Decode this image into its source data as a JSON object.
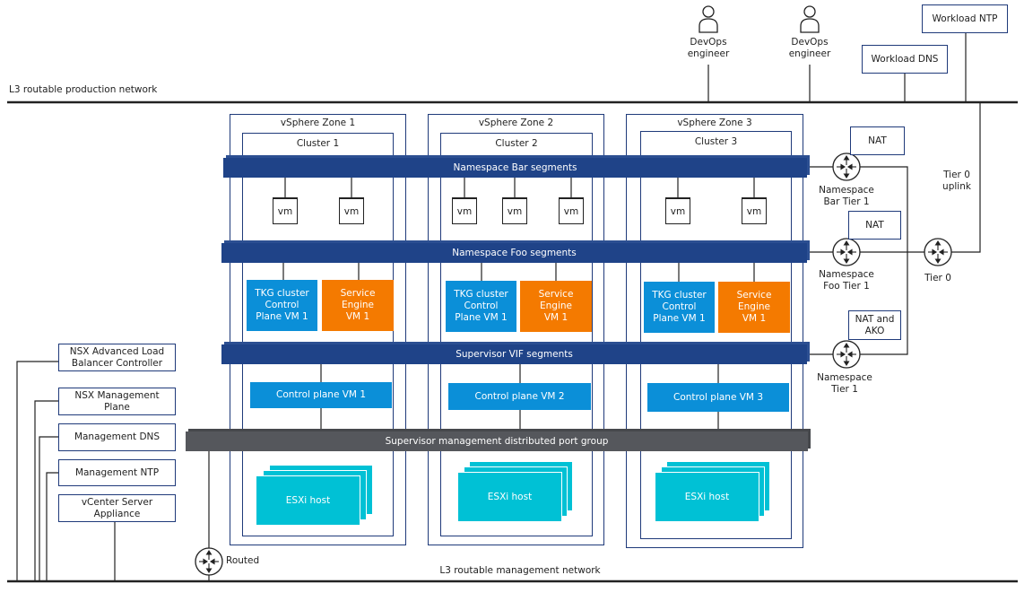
{
  "networks": {
    "production": "L3 routable production network",
    "management": "L3 routable management network"
  },
  "top": {
    "devops": [
      "DevOps\nengineer",
      "DevOps\nengineer"
    ],
    "workload_ntp": "Workload NTP",
    "workload_dns": "Workload DNS",
    "tier0_uplink": "Tier 0\nuplink"
  },
  "zones": [
    {
      "label": "vSphere Zone 1",
      "cluster": "Cluster 1",
      "tkg": "TKG cluster\nControl\nPlane VM 1",
      "se": "Service\nEngine\nVM 1",
      "cp": "Control plane VM 1",
      "esxi": "ESXi host"
    },
    {
      "label": "vSphere Zone 2",
      "cluster": "Cluster 2",
      "tkg": "TKG cluster\nControl\nPlane VM 1",
      "se": "Service\nEngine\nVM 1",
      "cp": "Control plane VM 2",
      "esxi": "ESXi host"
    },
    {
      "label": "vSphere Zone 3",
      "cluster": "Cluster 3",
      "tkg": "TKG cluster\nControl\nPlane VM 1",
      "se": "Service\nEngine\nVM 1",
      "cp": "Control plane VM 3",
      "esxi": "ESXi host"
    }
  ],
  "vm_label": "vm",
  "segments": {
    "bar": "Namespace Bar segments",
    "foo": "Namespace Foo segments",
    "vif": "Supervisor VIF segments",
    "mgmt": "Supervisor management distributed port group"
  },
  "routers": {
    "bar_t1": "Namespace\nBar Tier 1",
    "foo_t1": "Namespace\nFoo Tier 1",
    "ns_t1": "Namespace\nTier 1",
    "tier0": "Tier 0",
    "routed": "Routed"
  },
  "nat": {
    "bar": "NAT",
    "foo": "NAT",
    "ns": "NAT and\nAKO"
  },
  "mgmt_components": [
    "NSX Advanced Load\nBalancer Controller",
    "NSX Management\nPlane",
    "Management DNS",
    "Management NTP",
    "vCenter Server\nAppliance"
  ],
  "colors": {
    "navy": "#1f4388",
    "grey_bar": "#55575c",
    "vm_blue": "#0b8fd8",
    "service_orange": "#f47a00",
    "esxi_cyan": "#00c1d5"
  }
}
